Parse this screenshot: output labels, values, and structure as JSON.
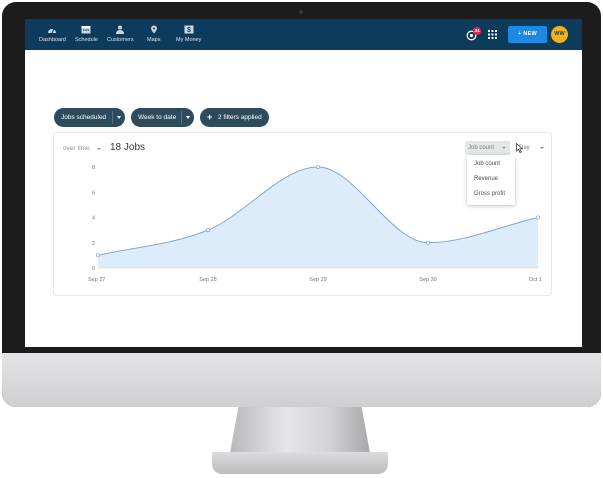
{
  "nav": {
    "items": [
      {
        "label": "Dashboard",
        "icon": "dashboard-gauge-icon"
      },
      {
        "label": "Schedule",
        "icon": "calendar-icon"
      },
      {
        "label": "Customers",
        "icon": "customers-icon"
      },
      {
        "label": "Maps",
        "icon": "map-pin-icon"
      },
      {
        "label": "My Money",
        "icon": "dollar-icon"
      }
    ],
    "notification_count": "34",
    "new_button": "+ NEW",
    "avatar_initials": "WW"
  },
  "filters": {
    "report": "Jobs scheduled",
    "period": "Week to date",
    "filters_applied": "2 filters applied",
    "add_icon": "+"
  },
  "chart_header": {
    "range_label": "over time",
    "total": "18 Jobs",
    "metric": "Job count",
    "interval": "Day",
    "metric_options": [
      "Job count",
      "Revenue",
      "Gross profit"
    ]
  },
  "chart_data": {
    "type": "area",
    "categories": [
      "Sep 27",
      "Sep 28",
      "Sep 29",
      "Sep 30",
      "Oct 1"
    ],
    "values": [
      1,
      3,
      8,
      2,
      4
    ],
    "ylim": [
      0,
      8
    ],
    "yticks": [
      0,
      2,
      4,
      6,
      8
    ],
    "xlabel": "",
    "ylabel": "",
    "grid": false,
    "colors": {
      "line": "#7fa9c8",
      "fill": "#dcecfb",
      "point": "#ffffff"
    }
  },
  "colors": {
    "topbar": "#0d3b5c",
    "pill": "#2e4b5e",
    "new_button": "#1e88e5",
    "avatar": "#f6b21b",
    "badge": "#e2264d"
  }
}
